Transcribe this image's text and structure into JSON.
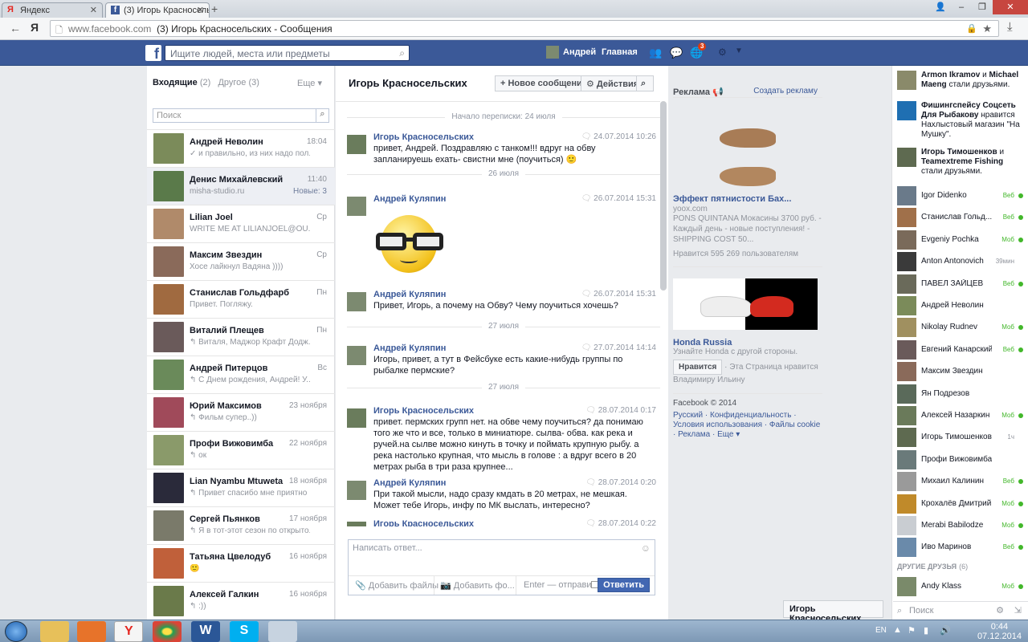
{
  "browser": {
    "tabs": [
      {
        "label": "Яндекс",
        "active": false
      },
      {
        "label": "(3) Игорь Красносельских",
        "active": true
      }
    ],
    "url_host": "www.facebook.com",
    "url_title": "(3) Игорь Красносельских - Сообщения"
  },
  "fb_header": {
    "search_placeholder": "Ищите людей, места или предметы",
    "user_name": "Андрей",
    "home_label": "Главная",
    "notifications_count": "3"
  },
  "inbox": {
    "tab_inbox": "Входящие",
    "tab_inbox_count": "(2)",
    "tab_other": "Другое",
    "tab_other_count": "(3)",
    "more_label": "Еще",
    "search_placeholder": "Поиск",
    "conversations": [
      {
        "name": "Андрей Неволин",
        "snippet": "✓ и правильно, из них надо пол...",
        "time": "18:04",
        "new": "",
        "color": "#7b8b5a"
      },
      {
        "name": "Денис Михайлевский",
        "snippet": "misha-studio.ru",
        "time": "11:40",
        "new": "Новые: 3",
        "color": "#5a7a4a"
      },
      {
        "name": "Lilian Joel",
        "snippet": "WRITE ME AT LILIANJOEL@OU...",
        "time": "Ср",
        "new": "",
        "color": "#b08a6a"
      },
      {
        "name": "Максим Звездин",
        "snippet": "Хосе лайкнул Вадяна ))))",
        "time": "Ср",
        "new": "",
        "color": "#8a6a5a"
      },
      {
        "name": "Станислав Гольдфарб",
        "snippet": "Привет. Погляжу.",
        "time": "Пн",
        "new": "",
        "color": "#a06a40"
      },
      {
        "name": "Виталий Плещев",
        "snippet": "↰ Виталя, Маджор Крафт Додж...",
        "time": "Пн",
        "new": "",
        "color": "#6a5a5a"
      },
      {
        "name": "Андрей Питерцов",
        "snippet": "↰ С Днем рождения, Андрей! У...",
        "time": "Вс",
        "new": "",
        "color": "#6a8a5a"
      },
      {
        "name": "Юрий Максимов",
        "snippet": "↰ Фильм супер..))",
        "time": "23 ноября",
        "new": "",
        "color": "#a04a5a"
      },
      {
        "name": "Профи Вижовимба",
        "snippet": "↰ ок",
        "time": "22 ноября",
        "new": "",
        "color": "#8a9a6a"
      },
      {
        "name": "Lian Nyambu Mtuweta",
        "snippet": "↰ Привет спасибо мне приятно",
        "time": "18 ноября",
        "new": "",
        "color": "#2a2a3a"
      },
      {
        "name": "Сергей Пьянков",
        "snippet": "↰ Я в тот-этот сезон по открыто...",
        "time": "17 ноября",
        "new": "",
        "color": "#7a7a6a"
      },
      {
        "name": "Татьяна Цвелодуб",
        "snippet": "🙂",
        "time": "16 ноября",
        "new": "",
        "color": "#c0603a"
      },
      {
        "name": "Алексей Галкин",
        "snippet": "↰ :))",
        "time": "16 ноября",
        "new": "",
        "color": "#6a7a4a"
      }
    ]
  },
  "thread": {
    "title": "Игорь Красносельских",
    "new_message_label": "Новое сообщение",
    "actions_label": "Действия",
    "start_label": "Начало переписки: 24 июля",
    "messages": [
      {
        "who": "Игорь Красносельских",
        "when": "24.07.2014 10:26",
        "text": "привет, Андрей. Поздравляю с танком!!! вдруг на обву запланируешь ехать- свистни мне (поучиться) 🙂"
      },
      {
        "sep": "26 июля"
      },
      {
        "who": "Андрей Куляпин",
        "when": "26.07.2014 15:31",
        "text": ""
      },
      {
        "who": "Андрей Куляпин",
        "when": "26.07.2014 15:31",
        "text": "Привет, Игорь, а почему на Обву? Чему поучиться хочешь?"
      },
      {
        "sep": "27 июля"
      },
      {
        "who": "Андрей Куляпин",
        "when": "27.07.2014 14:14",
        "text": "Игорь, привет, а тут в Фейсбуке есть какие-нибудь группы по рыбалке пермские?"
      },
      {
        "sep": "27 июля"
      },
      {
        "who": "Игорь Красносельских",
        "when": "28.07.2014 0:17",
        "text": "привет. пермских групп нет. на обве чему поучиться? да понимаю того же что и все, только в миниатюре. сылва- обва. как река и ручей.на сылве можно кинуть в точку и поймать крупную рыбу. а река настолько крупная, что мысль в голове : а вдруг всего в 20 метрах рыба  в три раза крупнее..."
      },
      {
        "who": "Андрей Куляпин",
        "when": "28.07.2014 0:20",
        "text": "При такой мысли, надо сразу кмдать в 20 метрах, не мешкая. Может тебе Игорь, инфу по МК выслать, интересно?"
      },
      {
        "who": "Игорь Красносельских",
        "when": "28.07.2014 0:22",
        "text": ""
      }
    ],
    "reply_placeholder": "Написать ответ...",
    "add_files": "Добавить файлы",
    "add_photo": "Добавить фо...",
    "enter_send": "Enter — отправить",
    "reply_button": "Ответить"
  },
  "ads": {
    "header": "Реклама",
    "create_ad": "Создать рекламу",
    "ad1_title": "Эффект пятнистости Бах...",
    "ad1_host": "yoox.com",
    "ad1_text": "PONS QUINTANA Мокасины 3700 руб. - Каждый день - новые поступления! - SHIPPING COST 50...",
    "ad1_likes": "Нравится 595 269 пользователям",
    "ad2_title": "Honda Russia",
    "ad2_text": "Узнайте Honda с другой стороны.",
    "ad2_like_button": "Нравится",
    "ad2_like_text": "· Эта Страница нравится Владимиру Ильину",
    "footer_copyright": "Facebook © 2014",
    "footer_links": "Русский · Конфиденциальность · Условия использования · Файлы cookie · Реклама · Еще ▾"
  },
  "ticker": [
    {
      "a": "Armon Ikramov",
      "mid": " и ",
      "b": "Michael Maeng",
      "rest": " стали друзьями."
    },
    {
      "a": "Фишингспейсу Соцсеть Для Рыбакову",
      "mid": " нравится ",
      "b": "",
      "rest": "Нахлыстовый магазин \"На Мушку\"."
    },
    {
      "a": "Игорь Тимошенков",
      "mid": " и ",
      "b": "Teamextreme Fishing",
      "rest": " стали друзьями."
    }
  ],
  "chat": {
    "friends": [
      {
        "name": "Igor Didenko",
        "status": "Веб",
        "online": true
      },
      {
        "name": "Станислав Гольд...",
        "status": "Веб",
        "online": true
      },
      {
        "name": "Evgeniy Pochka",
        "status": "Моб",
        "online": true
      },
      {
        "name": "Anton Antonovich",
        "status": "39мин",
        "online": false
      },
      {
        "name": "ПАВЕЛ ЗАЙЦЕВ",
        "status": "Веб",
        "online": true
      },
      {
        "name": "Андрей Неволин",
        "status": "",
        "online": false
      },
      {
        "name": "Nikolay Rudnev",
        "status": "Моб",
        "online": true
      },
      {
        "name": "Евгений Канарский",
        "status": "Веб",
        "online": true
      },
      {
        "name": "Максим Звездин",
        "status": "",
        "online": false
      },
      {
        "name": "Ян Подрезов",
        "status": "",
        "online": false
      },
      {
        "name": "Алексей Назаркин",
        "status": "Моб",
        "online": true
      },
      {
        "name": "Игорь Тимошенков",
        "status": "1ч",
        "online": false
      },
      {
        "name": "Профи Вижовимба",
        "status": "",
        "online": false
      },
      {
        "name": "Михаил Калинин",
        "status": "Веб",
        "online": true
      },
      {
        "name": "Крохалёв Дмитрий",
        "status": "Моб",
        "online": true
      },
      {
        "name": "Merabi Babilodze",
        "status": "Моб",
        "online": true
      },
      {
        "name": "Иво Маринов",
        "status": "Веб",
        "online": true
      }
    ],
    "other_friends_label": "ДРУГИЕ ДРУЗЬЯ",
    "other_friends_count": "(6)",
    "other_friend": {
      "name": "Andy Klass",
      "status": "Моб"
    },
    "search_placeholder": "Поиск",
    "open_chat_tab": "Игорь Красносельских"
  },
  "taskbar": {
    "lang": "EN",
    "time": "0:44",
    "date": "07.12.2014"
  },
  "colors": {
    "fb_blue": "#3b5998",
    "online_green": "#42b72a"
  }
}
